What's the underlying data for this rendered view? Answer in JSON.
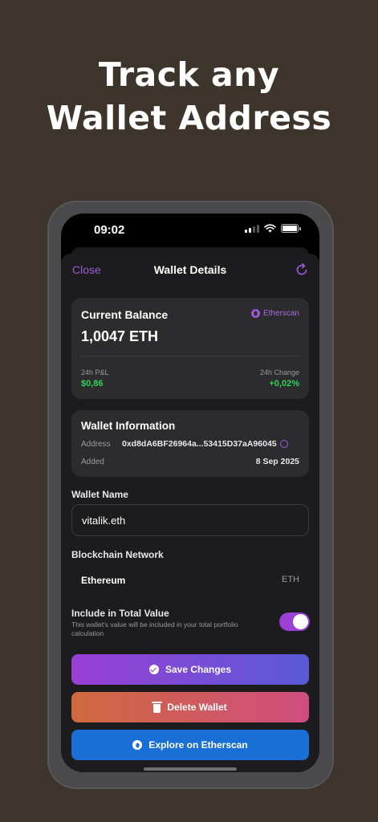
{
  "headline": {
    "line1": "Track any",
    "line2": "Wallet Address"
  },
  "status_bar": {
    "time": "09:02",
    "icons": [
      "signal-icon",
      "wifi-icon",
      "battery-icon"
    ]
  },
  "nav": {
    "close_label": "Close",
    "title": "Wallet Details",
    "refresh_icon": "refresh-icon"
  },
  "balance_card": {
    "title": "Current Balance",
    "etherscan_label": "Etherscan",
    "amount": "1,0047 ETH",
    "pnl_label": "24h P&L",
    "pnl_value": "$0,86",
    "change_label": "24h Change",
    "change_value": "+0,02%"
  },
  "wallet_info": {
    "title": "Wallet Information",
    "address_label": "Address",
    "address_value": "0xd8dA6BF26964a...53415D37aA96045",
    "added_label": "Added",
    "added_value": "8 Sep 2025"
  },
  "wallet_name": {
    "label": "Wallet Name",
    "value": "vitalik.eth"
  },
  "blockchain": {
    "label": "Blockchain Network",
    "name": "Ethereum",
    "symbol": "ETH"
  },
  "include_total": {
    "label": "Include in Total Value",
    "description": "This wallet's value will be included in your total portfolio calculation",
    "enabled": true
  },
  "buttons": {
    "save": "Save Changes",
    "delete": "Delete Wallet",
    "explore": "Explore on Etherscan"
  },
  "colors": {
    "accent": "#9b59d6",
    "positive": "#30d158",
    "explore_button": "#1a6fd6",
    "background": "#3d342c"
  }
}
